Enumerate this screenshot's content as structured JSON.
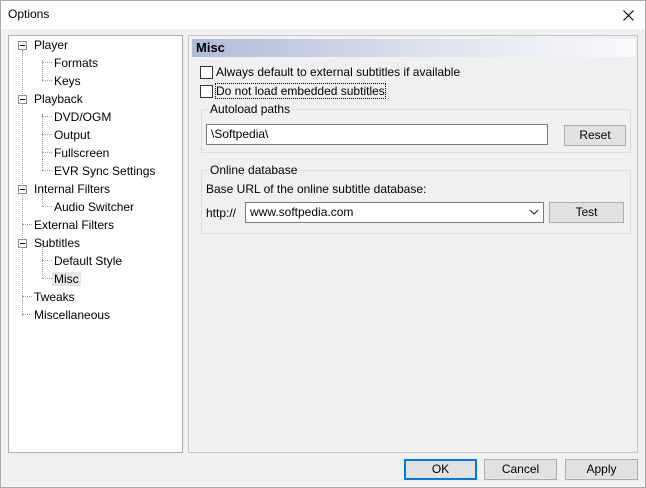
{
  "window": {
    "title": "Options"
  },
  "tree": {
    "items": [
      {
        "label": "Player"
      },
      {
        "label": "Formats"
      },
      {
        "label": "Keys"
      },
      {
        "label": "Playback"
      },
      {
        "label": "DVD/OGM"
      },
      {
        "label": "Output"
      },
      {
        "label": "Fullscreen"
      },
      {
        "label": "EVR Sync Settings"
      },
      {
        "label": "Internal Filters"
      },
      {
        "label": "Audio Switcher"
      },
      {
        "label": "External Filters"
      },
      {
        "label": "Subtitles"
      },
      {
        "label": "Default Style"
      },
      {
        "label": "Misc"
      },
      {
        "label": "Tweaks"
      },
      {
        "label": "Miscellaneous"
      }
    ],
    "selected": "Misc"
  },
  "page": {
    "header": "Misc",
    "checkbox_external": {
      "label": "Always default to external subtitles if available",
      "checked": false
    },
    "checkbox_embedded": {
      "label": "Do not load embedded subtitles",
      "checked": false
    },
    "autoload": {
      "title": "Autoload paths",
      "value": "\\Softpedia\\",
      "reset_label": "Reset"
    },
    "online_db": {
      "title": "Online database",
      "url_label": "Base URL of the online subtitle database:",
      "prefix": "http://",
      "value": "www.softpedia.com",
      "test_label": "Test"
    }
  },
  "buttons": {
    "ok": "OK",
    "cancel": "Cancel",
    "apply": "Apply"
  },
  "colors": {
    "focus": "#0078d7",
    "header_gradient_start": "#b0bbd6"
  }
}
